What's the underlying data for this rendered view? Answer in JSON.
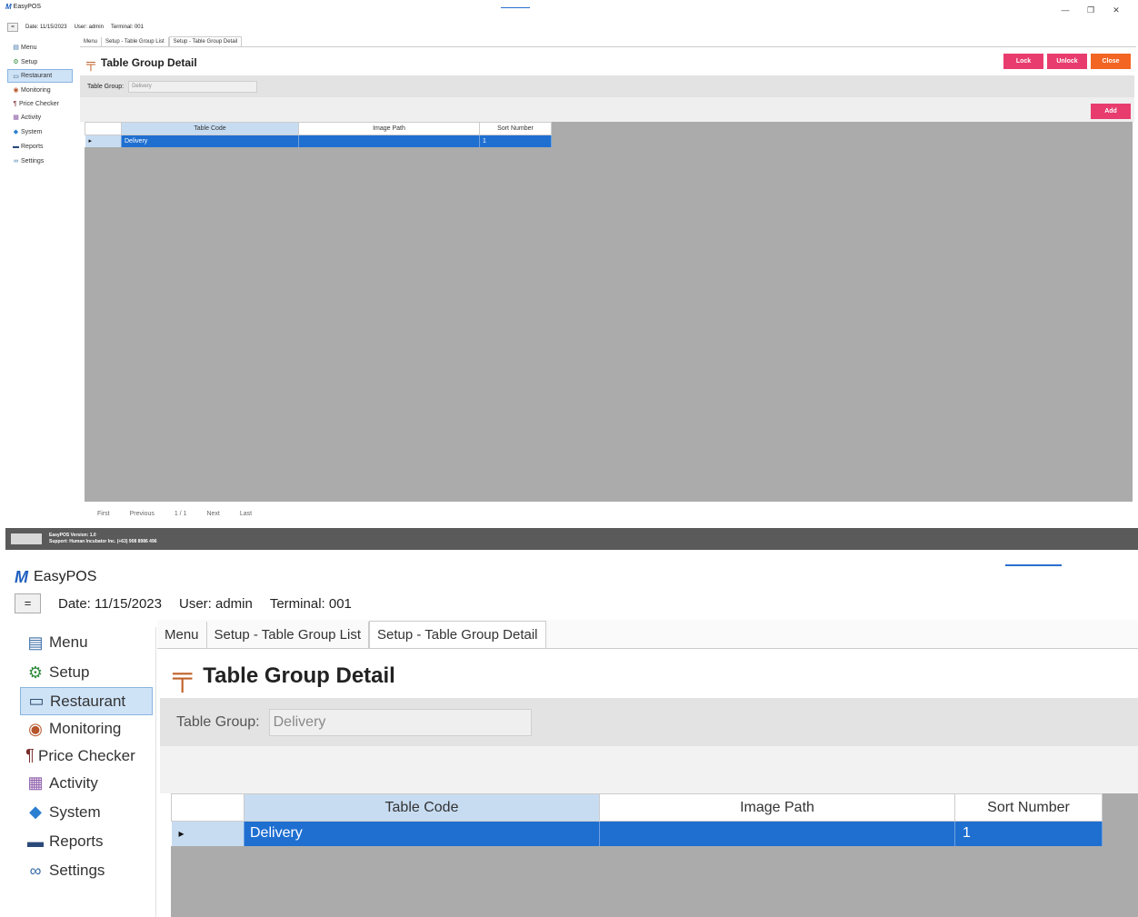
{
  "app": {
    "title": "EasyPOS"
  },
  "window_controls": {
    "minimize": "—",
    "restore": "❐",
    "close": "✕"
  },
  "infobar": {
    "toggle": "=",
    "date": "Date: 11/15/2023",
    "user": "User: admin",
    "terminal": "Terminal: 001"
  },
  "sidebar": {
    "items": [
      {
        "label": "Menu",
        "icon": "menu-icon"
      },
      {
        "label": "Setup",
        "icon": "setup-icon"
      },
      {
        "label": "Restaurant",
        "icon": "restaurant-icon",
        "active": true
      },
      {
        "label": "Monitoring",
        "icon": "monitoring-icon"
      },
      {
        "label": "Price Checker",
        "icon": "price-checker-icon"
      },
      {
        "label": "Activity",
        "icon": "activity-icon"
      },
      {
        "label": "System",
        "icon": "system-icon"
      },
      {
        "label": "Reports",
        "icon": "reports-icon"
      },
      {
        "label": "Settings",
        "icon": "settings-icon"
      }
    ]
  },
  "tabs": [
    {
      "label": "Menu"
    },
    {
      "label": "Setup - Table Group List"
    },
    {
      "label": "Setup - Table Group Detail",
      "active": true
    }
  ],
  "page": {
    "title": "Table Group Detail",
    "buttons": {
      "lock": "Lock",
      "unlock": "Unlock",
      "close": "Close",
      "add": "Add"
    },
    "field": {
      "label": "Table Group:",
      "value": "Delivery"
    }
  },
  "grid": {
    "columns": [
      "Table Code",
      "Image Path",
      "Sort Number"
    ],
    "rows": [
      {
        "marker": "▸",
        "table_code": "Delivery",
        "image_path": "",
        "sort_number": "1"
      }
    ]
  },
  "pager": {
    "first": "First",
    "previous": "Previous",
    "page": "1 / 1",
    "next": "Next",
    "last": "Last"
  },
  "status": {
    "version": "EasyPOS Version: 1.0",
    "support": "Support: Human Incubator Inc. (+63) 908 8986 496"
  },
  "colors": {
    "accent_blue": "#1f6fd1",
    "button_pink": "#e83c6e",
    "button_orange": "#f26522",
    "grid_bg": "#ababab",
    "status_bg": "#5a5a5a"
  }
}
